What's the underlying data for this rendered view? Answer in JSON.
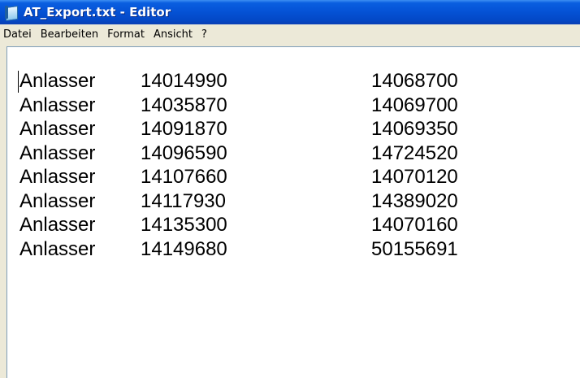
{
  "window": {
    "title": "AT_Export.txt - Editor",
    "icon": "notepad-icon"
  },
  "menu": {
    "items": [
      "Datei",
      "Bearbeiten",
      "Format",
      "Ansicht",
      "?"
    ]
  },
  "document": {
    "rows": [
      [
        "Anlasser",
        "14014990",
        "14068700"
      ],
      [
        "Anlasser",
        "14035870",
        "14069700"
      ],
      [
        "Anlasser",
        "14091870",
        "14069350"
      ],
      [
        "Anlasser",
        "14096590",
        "14724520"
      ],
      [
        "Anlasser",
        "14107660",
        "14070120"
      ],
      [
        "Anlasser",
        "14117930",
        "14389020"
      ],
      [
        "Anlasser",
        "14135300",
        "14070160"
      ],
      [
        "Anlasser",
        "14149680",
        "50155691"
      ]
    ]
  },
  "colors": {
    "titlebar": "#0553d6",
    "menubar": "#ece9d8",
    "editor_background": "#ffffff",
    "text": "#000000"
  }
}
